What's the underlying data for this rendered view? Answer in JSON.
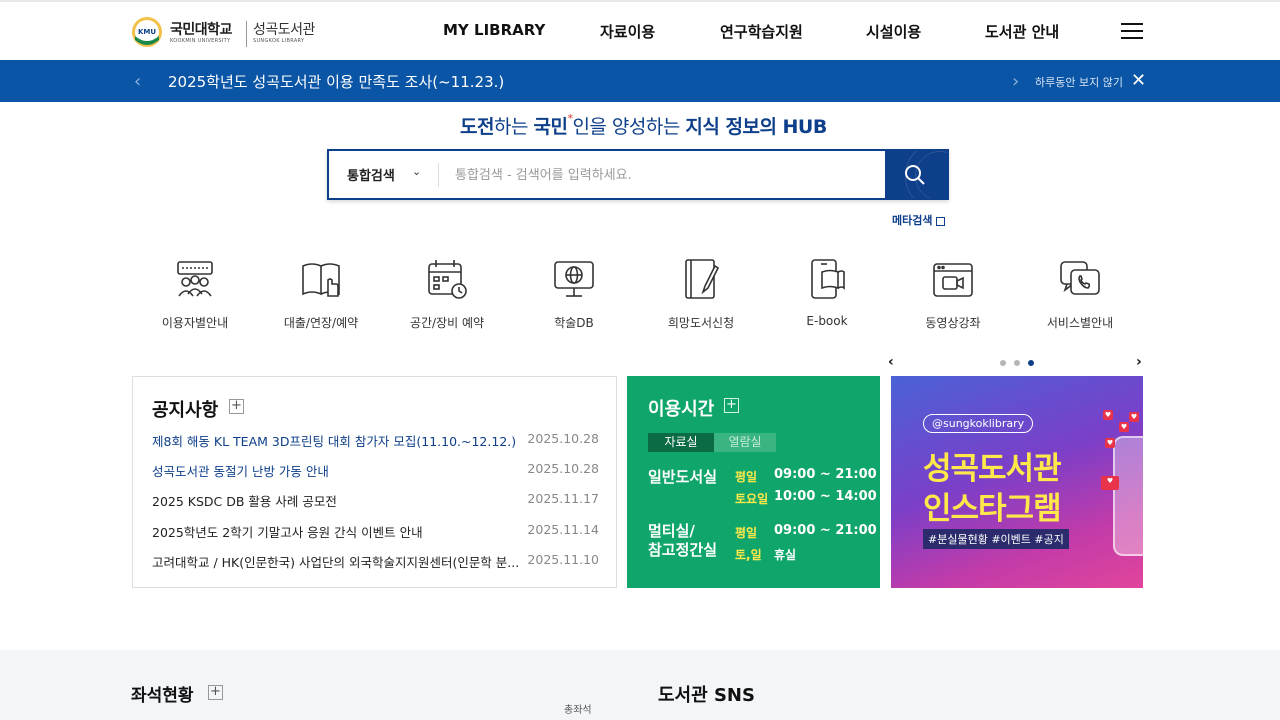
{
  "header": {
    "logo_text1": "국민대학교",
    "logo_sub1": "KOOKMIN UNIVERSITY",
    "logo_text2": "성곡도서관",
    "logo_sub2": "SUNGKOK LIBRARY",
    "logo_seal": "KMU",
    "nav": [
      "MY LIBRARY",
      "자료이용",
      "연구학습지원",
      "시설이용",
      "도서관 안내"
    ]
  },
  "notice_bar": {
    "text": "2025학년도 성곡도서관 이용 만족도 조사(~11.23.)",
    "hide_today": "하루동안 보지 않기"
  },
  "slogan": {
    "part1": "도전",
    "part2": "하는 ",
    "part3": "국민",
    "star": "*",
    "part4": "인을 양성하는 ",
    "part5": "지식 정보의 HUB"
  },
  "search": {
    "type": "통합검색",
    "placeholder": "통합검색 - 검색어를 입력하세요.",
    "meta": "메타검색"
  },
  "quick_links": [
    "이용자별안내",
    "대출/연장/예약",
    "공간/장비 예약",
    "학술DB",
    "희망도서신청",
    "E-book",
    "동영상강좌",
    "서비스별안내"
  ],
  "carousel": {
    "active_index": 2,
    "total": 3
  },
  "notices": {
    "title": "공지사항",
    "items": [
      {
        "title": "제8회 해동 KL TEAM 3D프린팅 대회 참가자 모집(11.10.~12.12.)",
        "date": "2025.10.28"
      },
      {
        "title": "성곡도서관 동절기 난방 가동 안내",
        "date": "2025.10.28"
      },
      {
        "title": "2025 KSDC DB 활용 사례 공모전",
        "date": "2025.11.17"
      },
      {
        "title": "2025학년도 2학기 기말고사 응원 간식 이벤트 안내",
        "date": "2025.11.14"
      },
      {
        "title": "고려대학교 / HK(인문한국) 사업단의 외국학술지지원센터(인문학 분...",
        "date": "2025.11.10"
      }
    ]
  },
  "hours": {
    "title": "이용시간",
    "tab_active": "자료실",
    "tab_inactive": "열람실",
    "place1": "일반도서실",
    "p1_day1": "평일",
    "p1_time1": "09:00 ~ 21:00",
    "p1_day2": "토요일",
    "p1_time2": "10:00 ~ 14:00",
    "place2_line1": "멀티실/",
    "place2_line2": "참고정간실",
    "p2_day1": "평일",
    "p2_time1": "09:00 ~ 21:00",
    "p2_day2": "토,일",
    "p2_time2": "휴실"
  },
  "banner": {
    "handle": "@sungkoklibrary",
    "line1": "성곡도서관",
    "line2": "인스타그램",
    "tags": "#분실물현황 #이벤트 #공지"
  },
  "bottom": {
    "seat_title": "좌석현황",
    "seat_total": "총좌석",
    "sns_title": "도서관 SNS"
  },
  "colors": {
    "brand": "#0e3f8a",
    "bar": "#0a55a6",
    "green": "#10a56b",
    "yellow": "#ffe94a"
  }
}
